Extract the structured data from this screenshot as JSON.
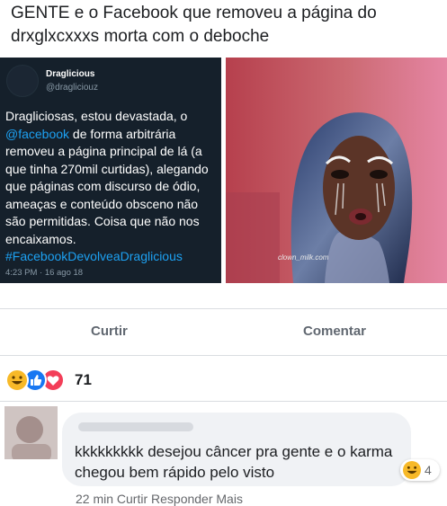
{
  "post": {
    "caption": "GENTE e o Facebook que removeu a página do drxglxcxxxs morta com o deboche"
  },
  "tweet": {
    "name": "Draglicious",
    "handle": "@dragliciouz",
    "body_1": "Dragliciosas, estou devastada, o ",
    "mention": "@facebook",
    "body_2": " de forma arbitrária removeu a página principal de lá (a que tinha 270mil curtidas), alegando que páginas com discurso de ódio, ameaças e conteúdo obsceno não são permitidas. Coisa que não nos encaixamos.",
    "hashtag": "#FacebookDevolveaDraglicious",
    "time": "4:23 PM · 16 ago 18"
  },
  "photo": {
    "watermark": "clown_milk.com"
  },
  "actions": {
    "like": "Curtir",
    "comment": "Comentar"
  },
  "reactions": {
    "types": [
      "haha",
      "like",
      "love"
    ],
    "count": "71"
  },
  "comment": {
    "text": "kkkkkkkkk desejou câncer pra gente e o karma chegou bem rápido pelo visto",
    "reaction_type": "haha",
    "reaction_count": "4",
    "meta": "22 min   Curtir   Responder   Mais"
  },
  "colors": {
    "tweet_bg": "#15202b",
    "tweet_link": "#1da1f2",
    "fb_like": "#1877f2",
    "fb_love": "#f33e58",
    "fb_haha": "#f7b928"
  }
}
